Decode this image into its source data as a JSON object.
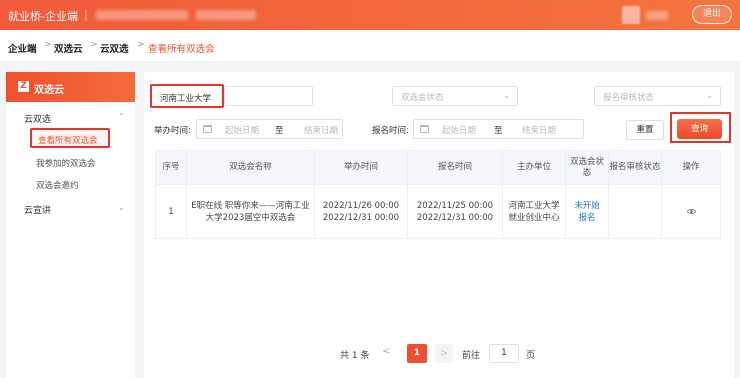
{
  "header": {
    "brand": "就业桥-企业端",
    "separator": "|",
    "logout": "退出"
  },
  "breadcrumb": {
    "items": [
      "企业端",
      "双选云",
      "云双选",
      "查看所有双选会"
    ],
    "arrow": ">"
  },
  "sidebar": {
    "title": "双选云",
    "logo_char": "Z",
    "groups": [
      {
        "label": "云双选",
        "chevron": "^",
        "items": [
          "查看所有双选会",
          "我参加的双选会",
          "双选会邀约"
        ]
      },
      {
        "label": "云宣讲",
        "chevron": "v"
      }
    ]
  },
  "filters": {
    "school_value": "河南工业大学",
    "status_placeholder": "双选会状态",
    "review_placeholder": "报名审核状态",
    "hold_time_label": "举办时间:",
    "signup_time_label": "报名时间:",
    "start_placeholder": "起始日期",
    "end_placeholder": "结束日期",
    "range_to": "至",
    "reset": "重置",
    "query": "查询"
  },
  "table": {
    "headers": [
      "序号",
      "双选会名称",
      "举办时间",
      "报名时间",
      "主办单位",
      "双选会状态",
      "报名审核状态",
      "操作"
    ],
    "rows": [
      {
        "index": "1",
        "name": "E职在线 职等你来——河南工业大学2023届空中双选会",
        "hold_start": "2022/11/26 00:00",
        "hold_end": "2022/12/31 00:00",
        "signup_start": "2022/11/25 00:00",
        "signup_end": "2022/12/31 00:00",
        "organizer": "河南工业大学就业创业中心",
        "status": "未开始报名",
        "review_status": "",
        "action_icon": "eye-icon"
      }
    ]
  },
  "pagination": {
    "total": "共 1 条",
    "prev": "<",
    "current": "1",
    "next": ">",
    "goto_label": "前往",
    "goto_value": "1",
    "goto_suffix": "页"
  },
  "colors": {
    "brand": "#f0502f",
    "highlight_box": "#e0372a",
    "link": "#1f7ae0"
  }
}
